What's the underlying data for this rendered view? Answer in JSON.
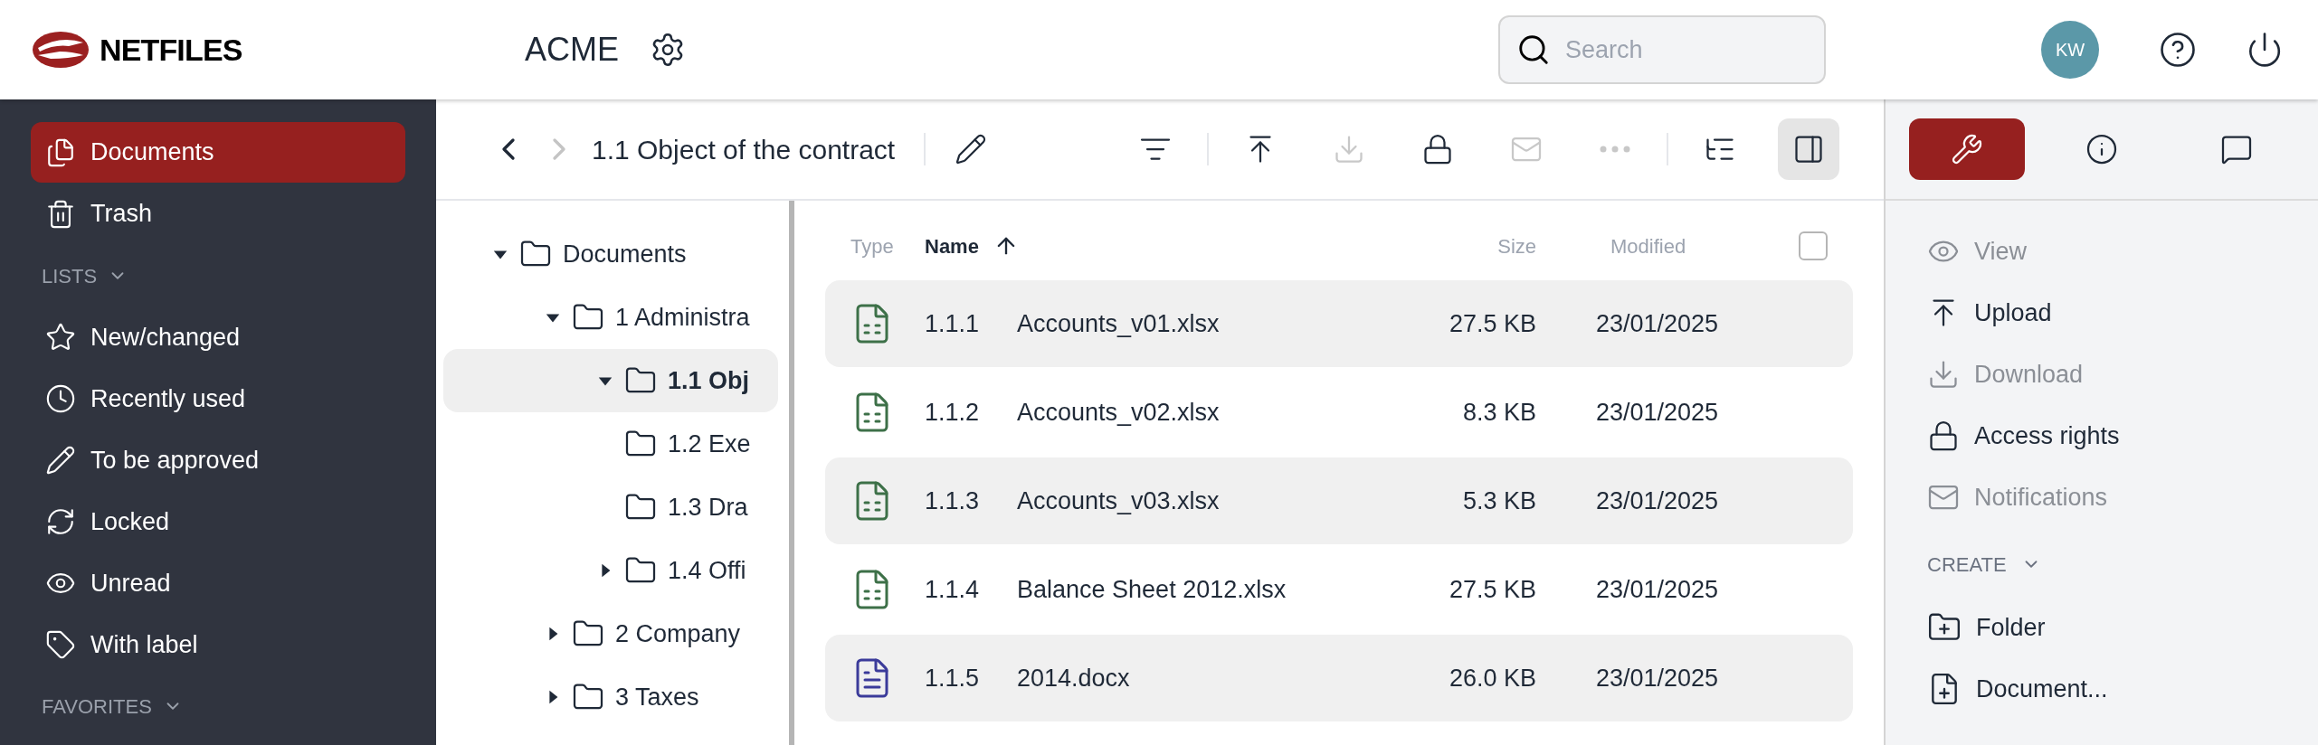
{
  "header": {
    "logo": "NETFILES",
    "workspace": "ACME",
    "search": {
      "placeholder": "Search"
    },
    "avatar": "KW"
  },
  "sidebar": {
    "items": [
      {
        "label": "Documents",
        "selected": true
      },
      {
        "label": "Trash",
        "selected": false
      }
    ],
    "sections": [
      {
        "title": "LISTS",
        "expanded": true,
        "items": [
          "New/changed",
          "Recently used",
          "To be approved",
          "Locked",
          "Unread",
          "With label"
        ]
      },
      {
        "title": "FAVORITES",
        "expanded": true
      }
    ]
  },
  "navigation": {
    "back_disabled": false,
    "forward_disabled": true,
    "title": "1.1 Object of the contract"
  },
  "toolbar": [
    {
      "disabled": false,
      "selected": false
    },
    {
      "disabled": false,
      "selected": false
    },
    {
      "disabled": true,
      "selected": false
    },
    {
      "disabled": false,
      "selected": false
    },
    {
      "disabled": true,
      "selected": false
    },
    {
      "disabled": true,
      "selected": false
    },
    {
      "disabled": false,
      "selected": false
    },
    {
      "disabled": false,
      "selected": true
    }
  ],
  "tree": [
    {
      "label": "Documents",
      "expanded": true,
      "selected": false,
      "children": [
        {
          "label": "1 Administra",
          "expanded": true,
          "selected": false,
          "children": [
            {
              "label": "1.1 Obj",
              "expanded": true,
              "selected": true
            },
            {
              "label": "1.2 Exe",
              "selected": false
            },
            {
              "label": "1.3 Dra",
              "selected": false
            },
            {
              "label": "1.4 Offi",
              "expanded": false,
              "selected": false
            }
          ]
        },
        {
          "label": "2 Company",
          "expanded": false,
          "selected": false
        },
        {
          "label": "3 Taxes",
          "expanded": false,
          "selected": false
        }
      ]
    }
  ],
  "table": {
    "columns": [
      {
        "label": "Type",
        "sorted": false
      },
      {
        "label": "Name",
        "sorted": true
      },
      {
        "label": "Size",
        "sorted": false
      },
      {
        "label": "Modified",
        "sorted": false
      }
    ],
    "select_all": false,
    "rows": [
      {
        "kind": "spreadsheet",
        "number": "1.1.1",
        "name": "Accounts_v01.xlsx",
        "size": "27.5 KB",
        "modified": "23/01/2025"
      },
      {
        "kind": "spreadsheet",
        "number": "1.1.2",
        "name": "Accounts_v02.xlsx",
        "size": "8.3 KB",
        "modified": "23/01/2025"
      },
      {
        "kind": "spreadsheet",
        "number": "1.1.3",
        "name": "Accounts_v03.xlsx",
        "size": "5.3 KB",
        "modified": "23/01/2025"
      },
      {
        "kind": "spreadsheet",
        "number": "1.1.4",
        "name": "Balance Sheet 2012.xlsx",
        "size": "27.5 KB",
        "modified": "23/01/2025"
      },
      {
        "kind": "document",
        "number": "1.1.5",
        "name": "2014.docx",
        "size": "26.0 KB",
        "modified": "23/01/2025"
      }
    ]
  },
  "panel": {
    "tabs": [
      {
        "selected": true
      },
      {
        "selected": false
      },
      {
        "selected": false
      }
    ],
    "actions": [
      {
        "label": "View",
        "disabled": true
      },
      {
        "label": "Upload",
        "disabled": false
      },
      {
        "label": "Download",
        "disabled": true
      },
      {
        "label": "Access rights",
        "disabled": false
      },
      {
        "label": "Notifications",
        "disabled": true
      }
    ],
    "create": {
      "title": "CREATE",
      "expanded": true,
      "items": [
        "Folder",
        "Document..."
      ]
    }
  }
}
